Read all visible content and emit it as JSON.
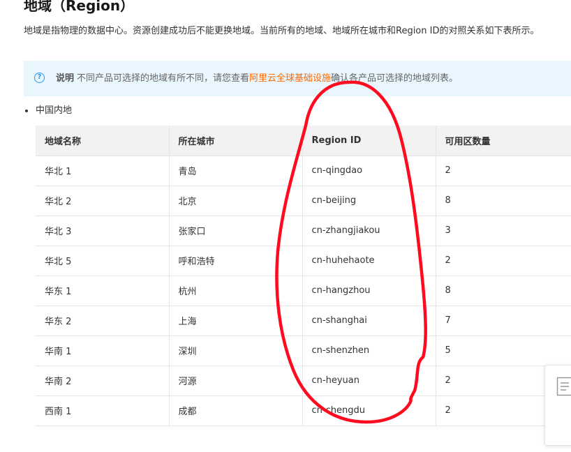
{
  "page_title": "地域（Region）",
  "intro": "地域是指物理的数据中心。资源创建成功后不能更换地域。当前所有的地域、地域所在城市和Region ID的对照关系如下表所示。",
  "note": {
    "icon": "question-circle-icon",
    "label": "说明",
    "text_before": "不同产品可选择的地域有所不同，请您查看",
    "link_text": "阿里云全球基础设施",
    "text_after": "确认各产品可选择的地域列表。",
    "background_color": "#e9f6fd",
    "link_color": "#ff6a00"
  },
  "section": {
    "bullet_label": "中国内地"
  },
  "table": {
    "headers": [
      "地域名称",
      "所在城市",
      "Region ID",
      "可用区数量"
    ],
    "rows": [
      [
        "华北 1",
        "青岛",
        "cn-qingdao",
        "2"
      ],
      [
        "华北 2",
        "北京",
        "cn-beijing",
        "8"
      ],
      [
        "华北 3",
        "张家口",
        "cn-zhangjiakou",
        "3"
      ],
      [
        "华北 5",
        "呼和浩特",
        "cn-huhehaote",
        "2"
      ],
      [
        "华东 1",
        "杭州",
        "cn-hangzhou",
        "8"
      ],
      [
        "华东 2",
        "上海",
        "cn-shanghai",
        "7"
      ],
      [
        "华南 1",
        "深圳",
        "cn-shenzhen",
        "5"
      ],
      [
        "华南 2",
        "河源",
        "cn-heyuan",
        "2"
      ],
      [
        "西南 1",
        "成都",
        "cn-chengdu",
        "2"
      ]
    ]
  },
  "annotation": {
    "shape": "hand-drawn loop around Region ID column",
    "color": "#ff0a1e"
  },
  "floating_widget": {
    "icon": "document-icon"
  }
}
